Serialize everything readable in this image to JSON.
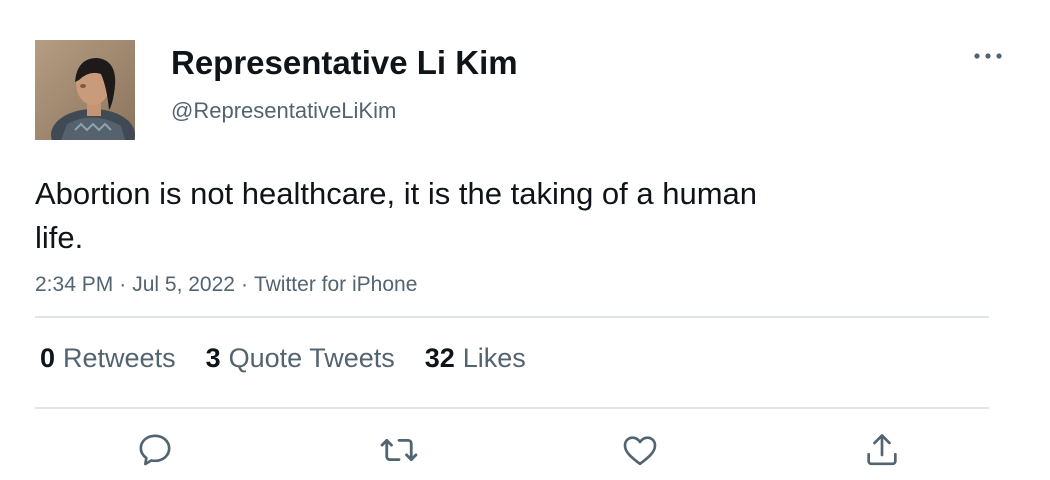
{
  "author": {
    "display_name": "Representative Li Kim",
    "handle": "@RepresentativeLiKim",
    "avatar_icon": "profile-photo"
  },
  "tweet": {
    "text": "Abortion is not healthcare, it is the taking of a human life.",
    "time": "2:34 PM",
    "date": "Jul 5, 2022",
    "source": "Twitter for iPhone",
    "separator": "·"
  },
  "stats": {
    "retweets": {
      "count": "0",
      "label": "Retweets"
    },
    "quote_tweets": {
      "count": "3",
      "label": "Quote Tweets"
    },
    "likes": {
      "count": "32",
      "label": "Likes"
    }
  },
  "actions": {
    "reply_icon": "reply-icon",
    "retweet_icon": "retweet-icon",
    "like_icon": "heart-icon",
    "share_icon": "share-icon",
    "more_icon": "more-icon"
  },
  "colors": {
    "text_primary": "#0f1419",
    "text_secondary": "#536471",
    "divider": "#e1e4e6",
    "icon": "#536471"
  }
}
